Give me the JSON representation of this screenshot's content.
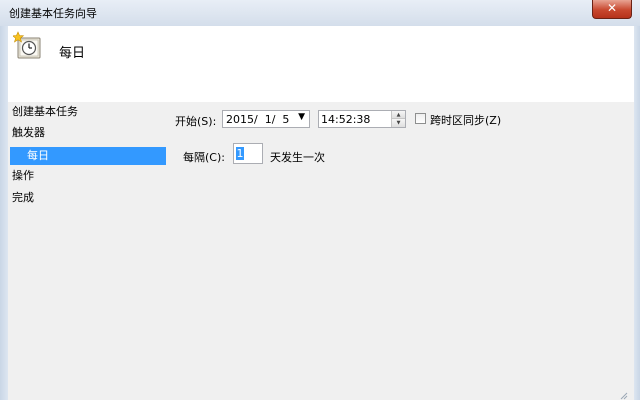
{
  "window": {
    "title": "创建基本任务向导",
    "close_glyph": "✕"
  },
  "header": {
    "title": "每日",
    "icon": "clock-schedule-icon"
  },
  "steps": [
    {
      "label": "创建基本任务",
      "selected": false
    },
    {
      "label": "触发器",
      "selected": false
    },
    {
      "label": "每日",
      "selected": true
    },
    {
      "label": "操作",
      "selected": false
    },
    {
      "label": "完成",
      "selected": false
    }
  ],
  "form": {
    "start_label": "开始(S):",
    "start_date": "2015/  1/  5",
    "start_time": "14:52:38",
    "sync_timezones_label": "跨时区同步(Z)",
    "sync_timezones_checked": false,
    "recur_label": "每隔(C):",
    "recur_value": "1",
    "recur_suffix": "天发生一次"
  },
  "colors": {
    "selection": "#3399ff",
    "panel_bg": "#f0f0f0",
    "close_button": "#c8482f"
  }
}
